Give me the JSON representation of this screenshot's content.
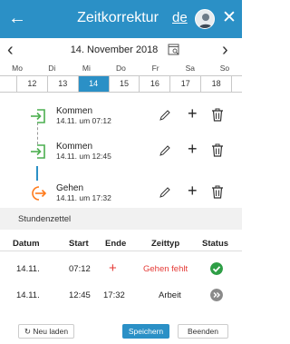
{
  "header": {
    "back_icon": "arrow-left-icon",
    "title": "Zeitkorrektur",
    "language": "de",
    "close_icon": "close-icon",
    "background": "#2b90c6"
  },
  "date_nav": {
    "prev_icon": "chevron-left-icon",
    "date": "14. November 2018",
    "calendar_icon": "calendar-search-icon",
    "next_icon": "chevron-right-icon"
  },
  "week": {
    "weekdays": [
      "Mo",
      "Di",
      "Mi",
      "Do",
      "Fr",
      "Sa",
      "So"
    ],
    "days": [
      "12",
      "13",
      "14",
      "15",
      "16",
      "17",
      "18"
    ],
    "selected_day": "14"
  },
  "entries": [
    {
      "label": "Kommen",
      "time": "14.11. um 07:12",
      "icon": "login-arrow-icon",
      "color": "#4caf50"
    },
    {
      "label": "Kommen",
      "time": "14.11. um 12:45",
      "icon": "login-arrow-icon",
      "color": "#4caf50"
    },
    {
      "label": "Gehen",
      "time": "14.11. um 17:32",
      "icon": "logout-arrow-icon",
      "color": "#ff7a1a"
    }
  ],
  "timesheet": {
    "title": "Stundenzettel",
    "columns": [
      "Datum",
      "Start",
      "Ende",
      "Zeittyp",
      "Status"
    ],
    "rows": [
      {
        "date": "14.11.",
        "start": "07:12",
        "end": "+",
        "type": "Gehen fehlt",
        "status": "ok"
      },
      {
        "date": "14.11.",
        "start": "12:45",
        "end": "17:32",
        "type": "Arbeit",
        "status": "next"
      }
    ]
  },
  "footer": {
    "reload_label": "Neu laden",
    "save_label": "Speichern",
    "end_label": "Beenden"
  },
  "colors": {
    "accent": "#2b90c6",
    "error": "#e53935",
    "success": "#2e9e46",
    "come": "#4caf50",
    "go": "#ff7a1a"
  }
}
